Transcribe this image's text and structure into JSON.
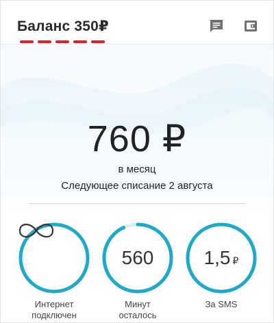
{
  "header": {
    "balance_label": "Баланс 350₽",
    "chat_icon": "chat-icon",
    "wallet_icon": "wallet-icon"
  },
  "tariff": {
    "price": "760 ₽",
    "period": "в месяц",
    "next_charge": "Следующее списание 2 августа"
  },
  "rings": [
    {
      "value": "∞",
      "label_line1": "Интернет",
      "label_line2": "подключен",
      "fill": 1.0
    },
    {
      "value": "560",
      "label_line1": "Минут",
      "label_line2": "осталось",
      "fill": 0.93
    },
    {
      "value": "1,5",
      "currency": "₽",
      "label_line1": "За SMS",
      "label_line2": "",
      "fill": 1.0
    }
  ],
  "colors": {
    "accent_ring": "#1fa9c9",
    "ring_track": "#d6edf5",
    "brand_red": "#e31e24",
    "hero_bg": "#dff0fa"
  }
}
